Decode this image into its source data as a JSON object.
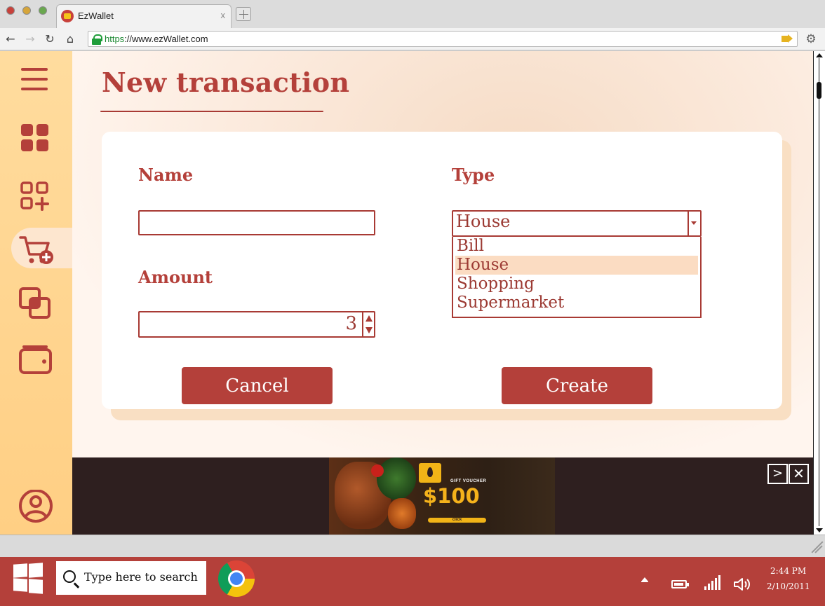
{
  "browser": {
    "tab_title": "EzWallet",
    "tab_close": "x",
    "url_scheme": "https",
    "url_rest": "://www.ezWallet.com"
  },
  "sidebar": {
    "items": [
      {
        "name": "menu",
        "icon": "hamburger-menu-icon"
      },
      {
        "name": "dashboard",
        "icon": "grid-icon"
      },
      {
        "name": "add-category",
        "icon": "grid-plus-icon"
      },
      {
        "name": "new-transaction",
        "icon": "cart-plus-icon",
        "active": true
      },
      {
        "name": "transactions",
        "icon": "copy-squares-icon"
      },
      {
        "name": "wallet",
        "icon": "wallet-icon"
      },
      {
        "name": "profile",
        "icon": "user-circle-icon"
      }
    ]
  },
  "page": {
    "title": "New transaction"
  },
  "form": {
    "name_label": "Name",
    "name_value": "",
    "amount_label": "Amount",
    "amount_value": "3",
    "type_label": "Type",
    "type_value": "House",
    "type_options": [
      "Bill",
      "House",
      "Shopping",
      "Supermarket"
    ],
    "cancel_label": "Cancel",
    "create_label": "Create"
  },
  "ad": {
    "voucher_text": "GIFT VOUCHER",
    "amount": "$100",
    "cta": "click",
    "next_label": ">",
    "close_label": "✕"
  },
  "taskbar": {
    "search_placeholder": "Type here to search",
    "time": "2:44 PM",
    "date": "2/10/2011"
  },
  "colors": {
    "accent": "#b4403a",
    "sidebar": "#ffd58f",
    "background": "#fff5ee",
    "selected_option": "#fbdcc2"
  }
}
